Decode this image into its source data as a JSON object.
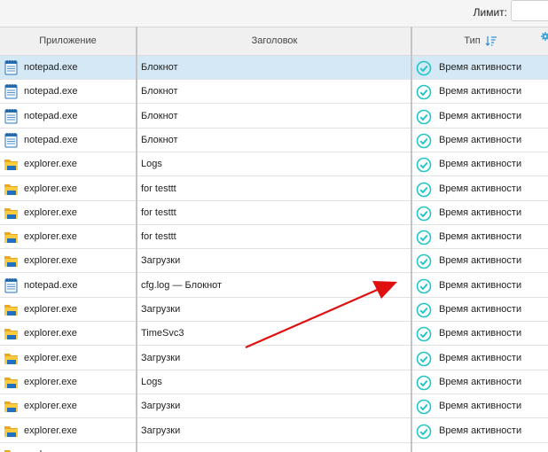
{
  "toolbar": {
    "limit_label": "Лимит:",
    "limit_value": ""
  },
  "columns": {
    "app": "Приложение",
    "title": "Заголовок",
    "type": "Тип"
  },
  "icons": {
    "sort": "sort-descending-icon",
    "settings": "gear-icon",
    "notepad": "notepad-icon",
    "explorer": "folder-icon",
    "check": "check-circle-icon"
  },
  "colors": {
    "selected_row": "#d4e8f6",
    "check": "#1fc5c8",
    "arrow": "#e01010"
  },
  "rows": [
    {
      "app": "notepad.exe",
      "icon": "notepad",
      "title": "Блокнот",
      "type": "Время активности",
      "selected": true
    },
    {
      "app": "notepad.exe",
      "icon": "notepad",
      "title": "Блокнот",
      "type": "Время активности"
    },
    {
      "app": "notepad.exe",
      "icon": "notepad",
      "title": "Блокнот",
      "type": "Время активности"
    },
    {
      "app": "notepad.exe",
      "icon": "notepad",
      "title": "Блокнот",
      "type": "Время активности"
    },
    {
      "app": "explorer.exe",
      "icon": "explorer",
      "title": "Logs",
      "type": "Время активности"
    },
    {
      "app": "explorer.exe",
      "icon": "explorer",
      "title": "for testtt",
      "type": "Время активности"
    },
    {
      "app": "explorer.exe",
      "icon": "explorer",
      "title": "for testtt",
      "type": "Время активности"
    },
    {
      "app": "explorer.exe",
      "icon": "explorer",
      "title": "for testtt",
      "type": "Время активности"
    },
    {
      "app": "explorer.exe",
      "icon": "explorer",
      "title": "Загрузки",
      "type": "Время активности"
    },
    {
      "app": "notepad.exe",
      "icon": "notepad",
      "title": "cfg.log — Блокнот",
      "type": "Время активности"
    },
    {
      "app": "explorer.exe",
      "icon": "explorer",
      "title": "Загрузки",
      "type": "Время активности"
    },
    {
      "app": "explorer.exe",
      "icon": "explorer",
      "title": "TimeSvc3",
      "type": "Время активности"
    },
    {
      "app": "explorer.exe",
      "icon": "explorer",
      "title": "Загрузки",
      "type": "Время активности"
    },
    {
      "app": "explorer.exe",
      "icon": "explorer",
      "title": "Logs",
      "type": "Время активности"
    },
    {
      "app": "explorer.exe",
      "icon": "explorer",
      "title": "Загрузки",
      "type": "Время активности"
    },
    {
      "app": "explorer.exe",
      "icon": "explorer",
      "title": "Загрузки",
      "type": "Время активности"
    },
    {
      "app": "explorer.exe",
      "icon": "explorer",
      "title": "",
      "type": ""
    }
  ]
}
